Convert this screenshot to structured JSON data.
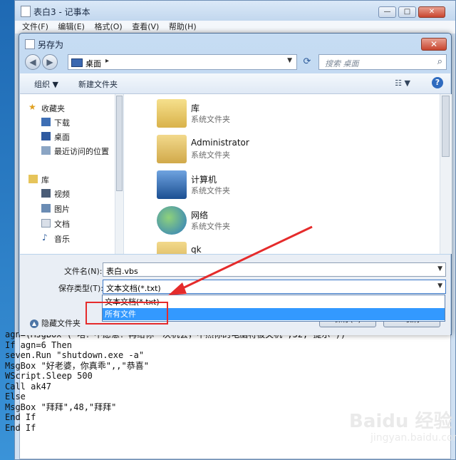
{
  "notepad": {
    "title": "表白3 - 记事本",
    "menu": [
      "文件(F)",
      "编辑(E)",
      "格式(O)",
      "查看(V)",
      "帮助(H)"
    ],
    "code_lines": [
      "agn=(MsgBox (\"啥？不愿意？再给你一次机会，不然你的电脑将被关机\",52,\"提示\"))",
      "If agn=6 Then",
      "seven.Run \"shutdown.exe -a\"",
      "MsgBox \"好老婆，你真乖\",,\"恭喜\"",
      "WScript.Sleep 500",
      "Call ak47",
      "Else",
      "MsgBox \"拜拜\",48,\"拜拜\"",
      "End If",
      "End If"
    ]
  },
  "dialog": {
    "title": "另存为",
    "address": "桌面",
    "search_placeholder": "搜索 桌面",
    "toolbar": {
      "organize": "组织 ▼",
      "new_folder": "新建文件夹"
    },
    "sidebar": [
      {
        "label": "收藏夹",
        "icon": "star-icon"
      },
      {
        "label": "下载",
        "icon": "download-folder-icon"
      },
      {
        "label": "桌面",
        "icon": "desktop-icon"
      },
      {
        "label": "最近访问的位置",
        "icon": "recent-places-icon"
      },
      {
        "label": "库",
        "icon": "library-icon"
      },
      {
        "label": "视频",
        "icon": "video-icon"
      },
      {
        "label": "图片",
        "icon": "pictures-icon"
      },
      {
        "label": "文档",
        "icon": "documents-icon"
      },
      {
        "label": "音乐",
        "icon": "music-icon"
      }
    ],
    "files": [
      {
        "name": "库",
        "desc": "系统文件夹",
        "icon": "library-folder-icon"
      },
      {
        "name": "Administrator",
        "desc": "系统文件夹",
        "icon": "user-folder-icon"
      },
      {
        "name": "计算机",
        "desc": "系统文件夹",
        "icon": "computer-icon"
      },
      {
        "name": "网络",
        "desc": "系统文件夹",
        "icon": "network-icon"
      },
      {
        "name": "qk",
        "desc": "",
        "icon": "folder-icon"
      }
    ],
    "filename_label": "文件名(N):",
    "filename_value": "表白.vbs",
    "filetype_label": "保存类型(T):",
    "filetype_value": "文本文档(*.txt)",
    "filetype_options": [
      "文本文档(*.txt)",
      "所有文件"
    ],
    "hide_folders": "隐藏文件夹",
    "save_button": "保存(S)",
    "cancel_button": "取消"
  },
  "watermark": "Baidu 经验",
  "watermark_sub": "jingyan.baidu.com"
}
